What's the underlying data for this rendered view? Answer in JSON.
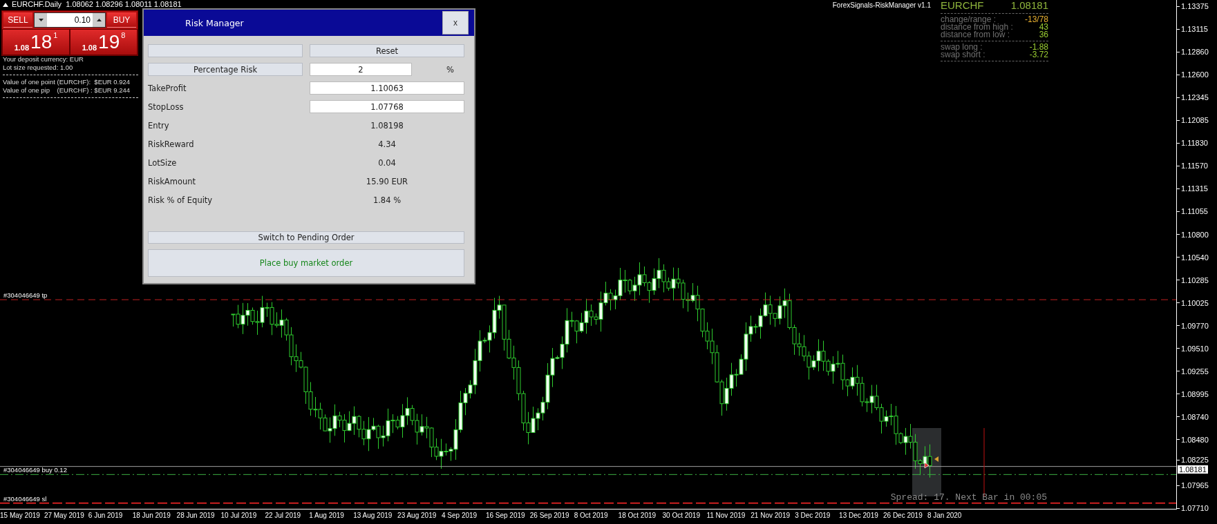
{
  "chart_title": "EURCHF.Daily  1.08062 1.08296 1.08011 1.08181",
  "one_click_panel": {
    "sell_label": "SELL",
    "buy_label": "BUY",
    "volume": "0.10",
    "sell_price": {
      "big": "1.08",
      "pips": "18",
      "point": "1"
    },
    "buy_price": {
      "big": "1.08",
      "pips": "19",
      "point": "8"
    }
  },
  "account_info": [
    [
      "Your deposit currency: EUR",
      "Lot size requested: 1.00"
    ],
    [
      "Value of one point (EURCHF):  $EUR 0.924",
      "Value of one pip    (EURCHF) : $EUR 9.244"
    ]
  ],
  "risk_manager": {
    "title": "Risk Manager",
    "close": "x",
    "reset": "Reset",
    "percentage_risk": {
      "label": "Percentage Risk",
      "value": "2",
      "unit": "%"
    },
    "inputs": [
      {
        "label": "TakeProfit",
        "value": "1.10063"
      },
      {
        "label": "StopLoss",
        "value": "1.07768"
      }
    ],
    "results": [
      {
        "label": "Entry",
        "value": "1.08198"
      },
      {
        "label": "RiskReward",
        "value": "4.34"
      },
      {
        "label": "LotSize",
        "value": "0.04"
      },
      {
        "label": "RiskAmount",
        "value": "15.90 EUR"
      },
      {
        "label": "Risk % of Equity",
        "value": "1.84 %"
      }
    ],
    "switch_button": "Switch to Pending Order",
    "place_button": "Place buy market order"
  },
  "stats": {
    "indicator": "ForexSignals-RiskManager v1.1",
    "symbol": "EURCHF",
    "price": "1.08181",
    "groups": [
      [
        {
          "label": "change/range :",
          "value": "-13/78",
          "color": "#e8b030"
        },
        {
          "label": "distance from high :",
          "value": "43",
          "color": "#9acd32"
        },
        {
          "label": "distance from low :",
          "value": "36",
          "color": "#9acd32"
        }
      ],
      [
        {
          "label": "swap long :",
          "value": "-1.88",
          "color": "#9acd32"
        },
        {
          "label": "swap short :",
          "value": "-3.72",
          "color": "#9acd32"
        }
      ]
    ]
  },
  "trade_lines": [
    {
      "kind": "tp",
      "label": "#304046649 tp"
    },
    {
      "kind": "entry",
      "label": "#304046649 buy 0.12"
    },
    {
      "kind": "sl",
      "label": "#304046649 sl"
    }
  ],
  "status": "Spread: 17. Next Bar in 00:05",
  "price_axis": {
    "current": "1.08181",
    "ticks": [
      "1.13375",
      "1.13115",
      "1.12860",
      "1.12600",
      "1.12345",
      "1.12085",
      "1.11830",
      "1.11570",
      "1.11315",
      "1.11055",
      "1.10800",
      "1.10540",
      "1.10285",
      "1.10025",
      "1.09770",
      "1.09510",
      "1.09255",
      "1.08995",
      "1.08740",
      "1.08480",
      "1.08225",
      "1.07965",
      "1.07710"
    ]
  },
  "time_axis": [
    "15 May 2019",
    "27 May 2019",
    "6 Jun 2019",
    "18 Jun 2019",
    "28 Jun 2019",
    "10 Jul 2019",
    "22 Jul 2019",
    "1 Aug 2019",
    "13 Aug 2019",
    "23 Aug 2019",
    "4 Sep 2019",
    "16 Sep 2019",
    "26 Sep 2019",
    "8 Oct 2019",
    "18 Oct 2019",
    "30 Oct 2019",
    "11 Nov 2019",
    "21 Nov 2019",
    "3 Dec 2019",
    "13 Dec 2019",
    "26 Dec 2019",
    "8 Jan 2020"
  ]
}
